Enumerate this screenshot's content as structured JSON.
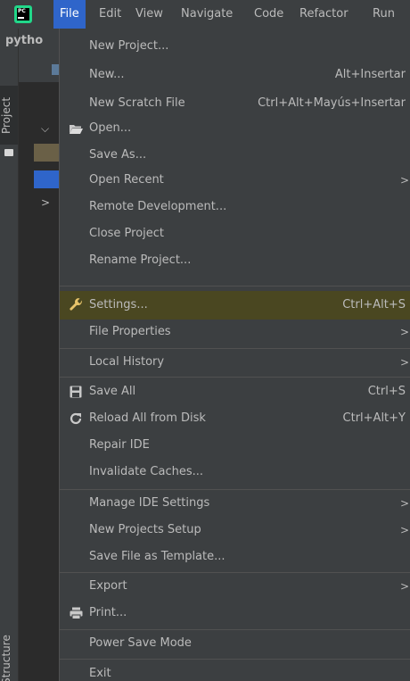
{
  "menubar": {
    "items": [
      {
        "label": "File",
        "active": true
      },
      {
        "label": "Edit"
      },
      {
        "label": "View"
      },
      {
        "label": "Navigate"
      },
      {
        "label": "Code"
      },
      {
        "label": "Refactor"
      },
      {
        "label": "Run"
      }
    ]
  },
  "left_strip": {
    "project_tab": "Project",
    "structure_tab": "Structure"
  },
  "project_panel": {
    "title": "pytho"
  },
  "file_menu": {
    "items": [
      {
        "label": "New Project...",
        "shortcut": "",
        "submenu": false
      },
      {
        "label": "New...",
        "shortcut": "Alt+Insertar",
        "submenu": false
      },
      {
        "label": "New Scratch File",
        "shortcut": "Ctrl+Alt+Mayús+Insertar",
        "submenu": false
      },
      {
        "label": "Open...",
        "shortcut": "",
        "submenu": false,
        "icon": "folder-open-icon"
      },
      {
        "label": "Save As...",
        "shortcut": "",
        "submenu": false
      },
      {
        "label": "Open Recent",
        "shortcut": "",
        "submenu": true
      },
      {
        "label": "Remote Development...",
        "shortcut": "",
        "submenu": false
      },
      {
        "label": "Close Project",
        "shortcut": "",
        "submenu": false
      },
      {
        "label": "Rename Project...",
        "shortcut": "",
        "submenu": false
      },
      {
        "label": "Settings...",
        "shortcut": "Ctrl+Alt+S",
        "submenu": false,
        "icon": "wrench-icon",
        "highlighted": true
      },
      {
        "label": "File Properties",
        "shortcut": "",
        "submenu": true
      },
      {
        "label": "Local History",
        "shortcut": "",
        "submenu": true
      },
      {
        "label": "Save All",
        "shortcut": "Ctrl+S",
        "submenu": false,
        "icon": "save-icon"
      },
      {
        "label": "Reload All from Disk",
        "shortcut": "Ctrl+Alt+Y",
        "submenu": false,
        "icon": "reload-icon"
      },
      {
        "label": "Repair IDE",
        "shortcut": "",
        "submenu": false
      },
      {
        "label": "Invalidate Caches...",
        "shortcut": "",
        "submenu": false
      },
      {
        "label": "Manage IDE Settings",
        "shortcut": "",
        "submenu": true
      },
      {
        "label": "New Projects Setup",
        "shortcut": "",
        "submenu": true
      },
      {
        "label": "Save File as Template...",
        "shortcut": "",
        "submenu": false
      },
      {
        "label": "Export",
        "shortcut": "",
        "submenu": true
      },
      {
        "label": "Print...",
        "shortcut": "",
        "submenu": false,
        "icon": "print-icon"
      },
      {
        "label": "Power Save Mode",
        "shortcut": "",
        "submenu": false
      },
      {
        "label": "Exit",
        "shortcut": "",
        "submenu": false
      }
    ]
  },
  "colors": {
    "menu_bg": "#3c3f41",
    "active_menu": "#2f65ca",
    "highlight_row": "#4a4721",
    "wrench": "#e8c46a"
  }
}
